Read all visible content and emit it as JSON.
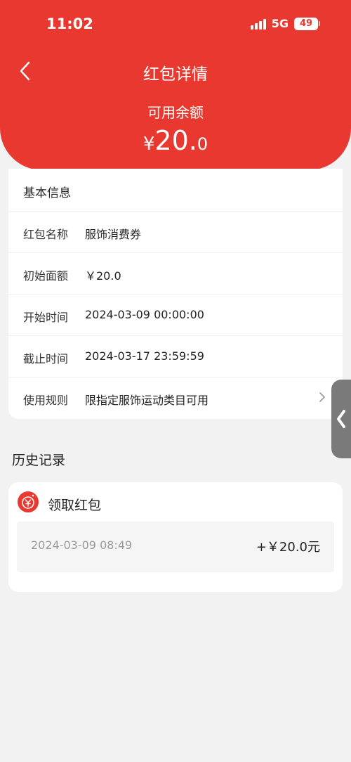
{
  "status_bar": {
    "time": "11:02",
    "network": "5G",
    "battery": "49"
  },
  "header": {
    "title": "红包详情",
    "balance_label": "可用余额",
    "currency": "¥",
    "balance_int": "20.",
    "balance_dec": "0"
  },
  "basic_info": {
    "title": "基本信息",
    "rows": [
      {
        "label": "红包名称",
        "value": "服饰消费券"
      },
      {
        "label": "初始面额",
        "value": "￥20.0"
      },
      {
        "label": "开始时间",
        "value": "2024-03-09 00:00:00"
      },
      {
        "label": "截止时间",
        "value": "2024-03-17 23:59:59"
      },
      {
        "label": "使用规则",
        "value": "限指定服饰运动类目可用"
      }
    ]
  },
  "history": {
    "title": "历史记录",
    "entry_name": "领取红包",
    "records": [
      {
        "date": "2024-03-09 08:49",
        "amount": "+￥20.0元"
      }
    ]
  },
  "colors": {
    "brand_red": "#e8382f",
    "background": "#f2f2f2"
  },
  "icons": {
    "back": "chevron-left-icon",
    "rule_more": "chevron-right-icon",
    "history_entry": "red-envelope-yuan-icon",
    "float_tab": "chevron-left-icon"
  }
}
